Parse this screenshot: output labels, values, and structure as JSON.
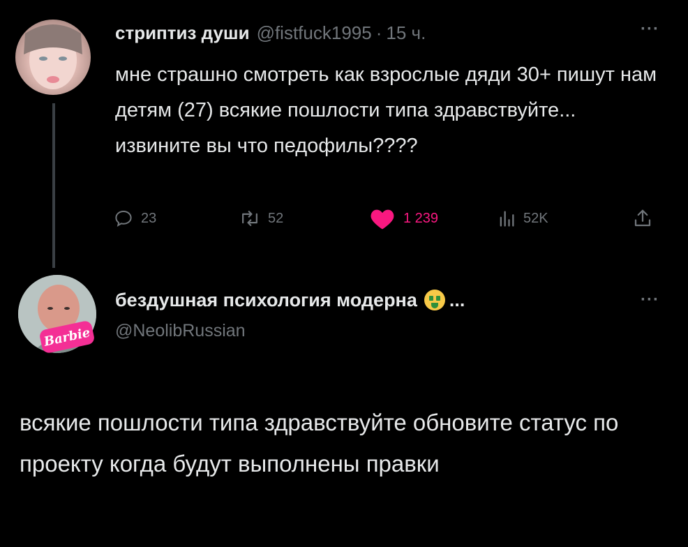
{
  "tweet1": {
    "display_name": "стриптиз души",
    "handle": "@fistfuck1995",
    "separator": "·",
    "time": "15 ч.",
    "more": "···",
    "text": "мне страшно смотреть как взрослые дяди 30+ пишут нам детям (27) всякие пошлости типа здравствуйте... извините вы что педофилы????",
    "actions": {
      "replies": "23",
      "reposts": "52",
      "likes": "1 239",
      "views": "52K"
    },
    "icons": {
      "reply": "reply-icon",
      "repost": "repost-icon",
      "like": "heart-icon",
      "views": "views-icon",
      "share": "share-icon"
    },
    "like_color": "#f91880"
  },
  "tweet2": {
    "display_name": "бездушная психология модерна",
    "ellipsis": "...",
    "handle": "@NeolibRussian",
    "avatar_badge": "Barbie",
    "more": "···",
    "text": "всякие пошлости типа здравствуйте обновите статус по проекту когда будут выполнены правки"
  },
  "colors": {
    "background": "#000000",
    "text": "#e7e9ea",
    "muted": "#71767b",
    "badge": "#f42f95"
  }
}
